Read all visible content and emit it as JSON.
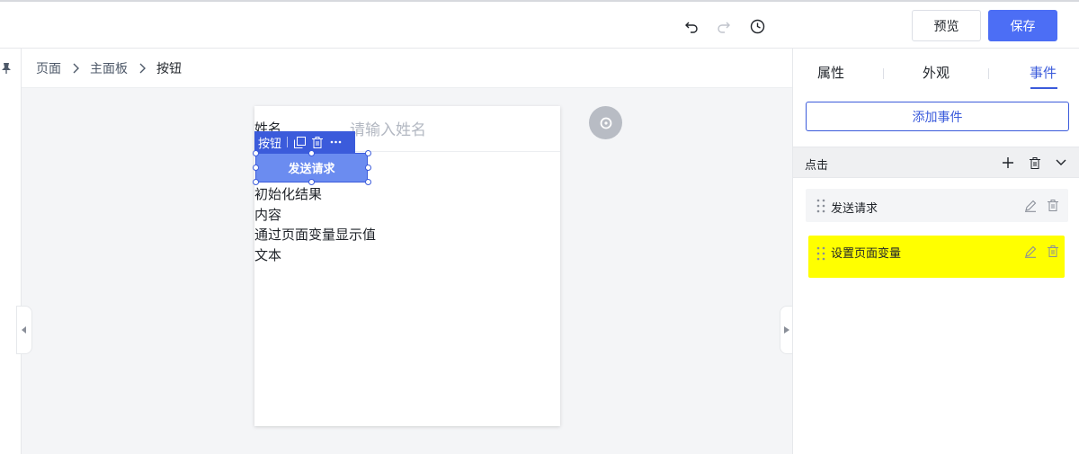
{
  "toolbar": {
    "preview_label": "预览",
    "save_label": "保存",
    "undo_icon": "undo-icon",
    "redo_icon": "redo-icon",
    "history_icon": "history-icon"
  },
  "breadcrumb": {
    "items": [
      "页面",
      "主面板",
      "按钮"
    ]
  },
  "canvas": {
    "field_label": "姓名",
    "field_placeholder": "请输入姓名",
    "selection_toolbar_label": "按钮",
    "button_label": "发送请求",
    "texts": [
      "初始化结果",
      "内容",
      "通过页面变量显示值",
      "文本"
    ]
  },
  "right_panel": {
    "tabs": [
      "属性",
      "外观",
      "事件"
    ],
    "active_tab": "事件",
    "add_event_label": "添加事件",
    "event_group_label": "点击",
    "actions": [
      {
        "label": "发送请求",
        "highlighted": false
      },
      {
        "label": "设置页面变量",
        "highlighted": true
      }
    ]
  },
  "colors": {
    "accent": "#3b5bdb",
    "save_button": "#4c6ef5",
    "highlight": "#ffff00"
  }
}
